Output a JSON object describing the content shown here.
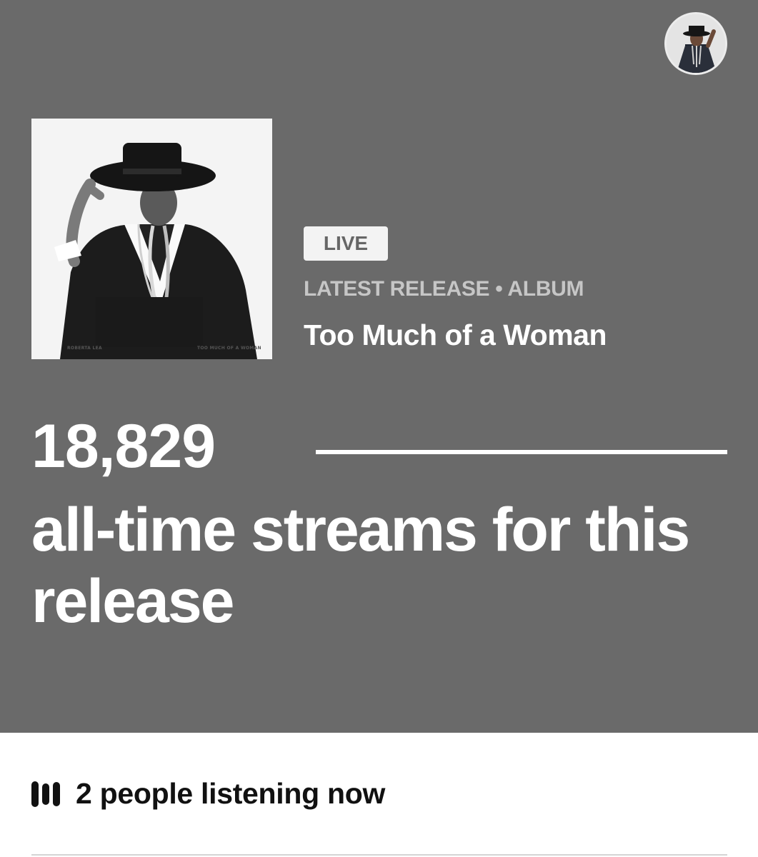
{
  "hero": {
    "avatar_icon": "artist-avatar",
    "album_cover": {
      "artist_text": "ROBERTA LEA",
      "title_text": "TOO MUCH OF A WOMAN"
    },
    "badge": "LIVE",
    "release_type": "LATEST RELEASE • ALBUM",
    "release_title": "Too Much of a Woman",
    "stream_count": "18,829",
    "stream_caption": "all-time streams for this release"
  },
  "listening": {
    "icon": "listening-bars-icon",
    "text": "2 people listening now"
  },
  "colors": {
    "hero_background": "#6a6a6a",
    "page_background": "#ffffff",
    "text_light": "#ffffff",
    "text_muted": "#c6c6c6",
    "text_dark": "#111111"
  }
}
